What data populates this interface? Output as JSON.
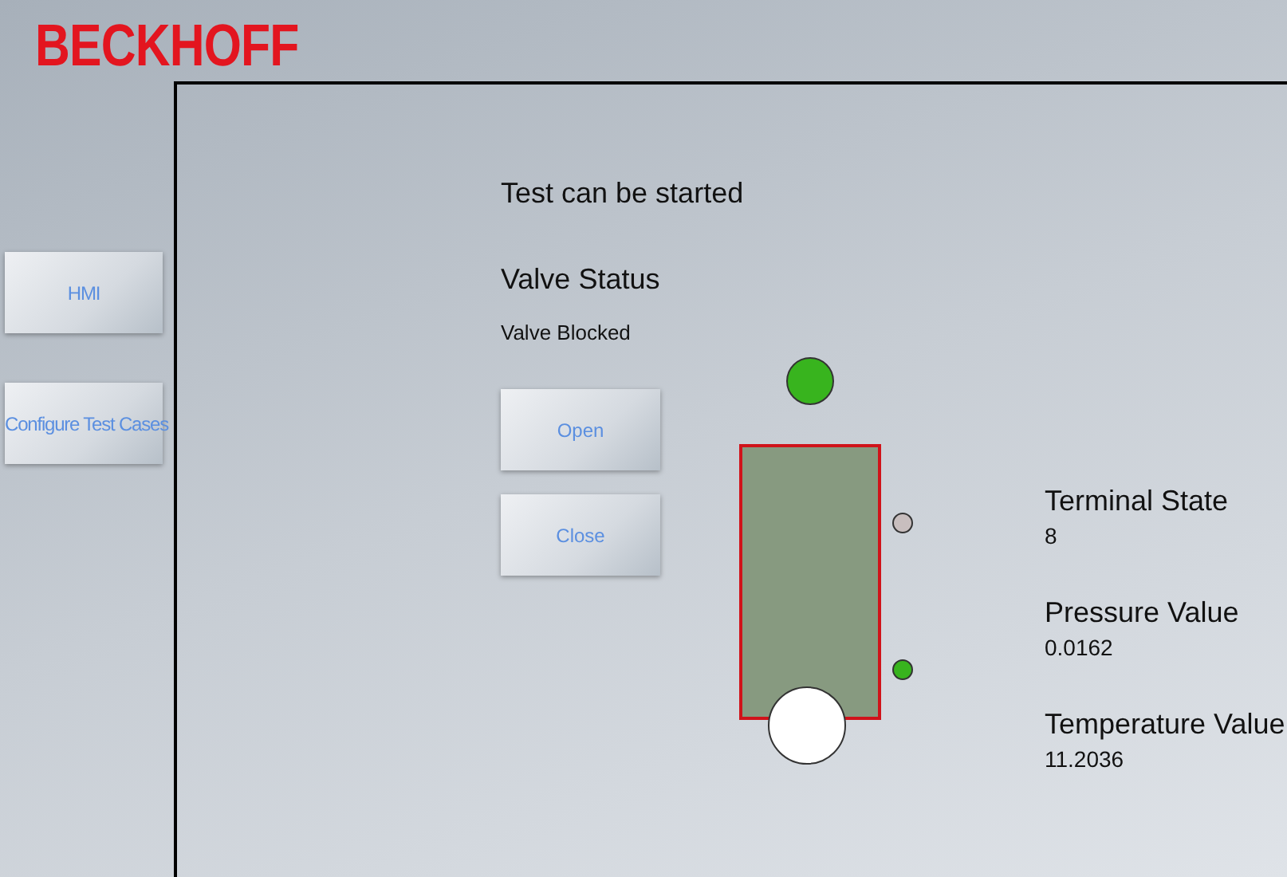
{
  "logo": "BECKHOFF",
  "nav": [
    {
      "label": "HMI"
    },
    {
      "label": "Configure Test Cases"
    }
  ],
  "status_message": "Test can be started",
  "valve": {
    "title": "Valve Status",
    "state": "Valve Blocked",
    "buttons": [
      "Open",
      "Close"
    ]
  },
  "diagram": {
    "indicators": [
      {
        "kind": "top-lamp",
        "color": "#38b41e"
      },
      {
        "kind": "upper-sensor",
        "color": "#c8bebe"
      },
      {
        "kind": "lower-sensor",
        "color": "#38b41e"
      },
      {
        "kind": "bottom-port",
        "color": "#ffffff"
      }
    ]
  },
  "readings": [
    {
      "label": "Terminal State",
      "value": "8"
    },
    {
      "label": "Pressure Value",
      "value": "0.0162"
    },
    {
      "label": "Temperature Value",
      "value": "11.2036"
    }
  ]
}
